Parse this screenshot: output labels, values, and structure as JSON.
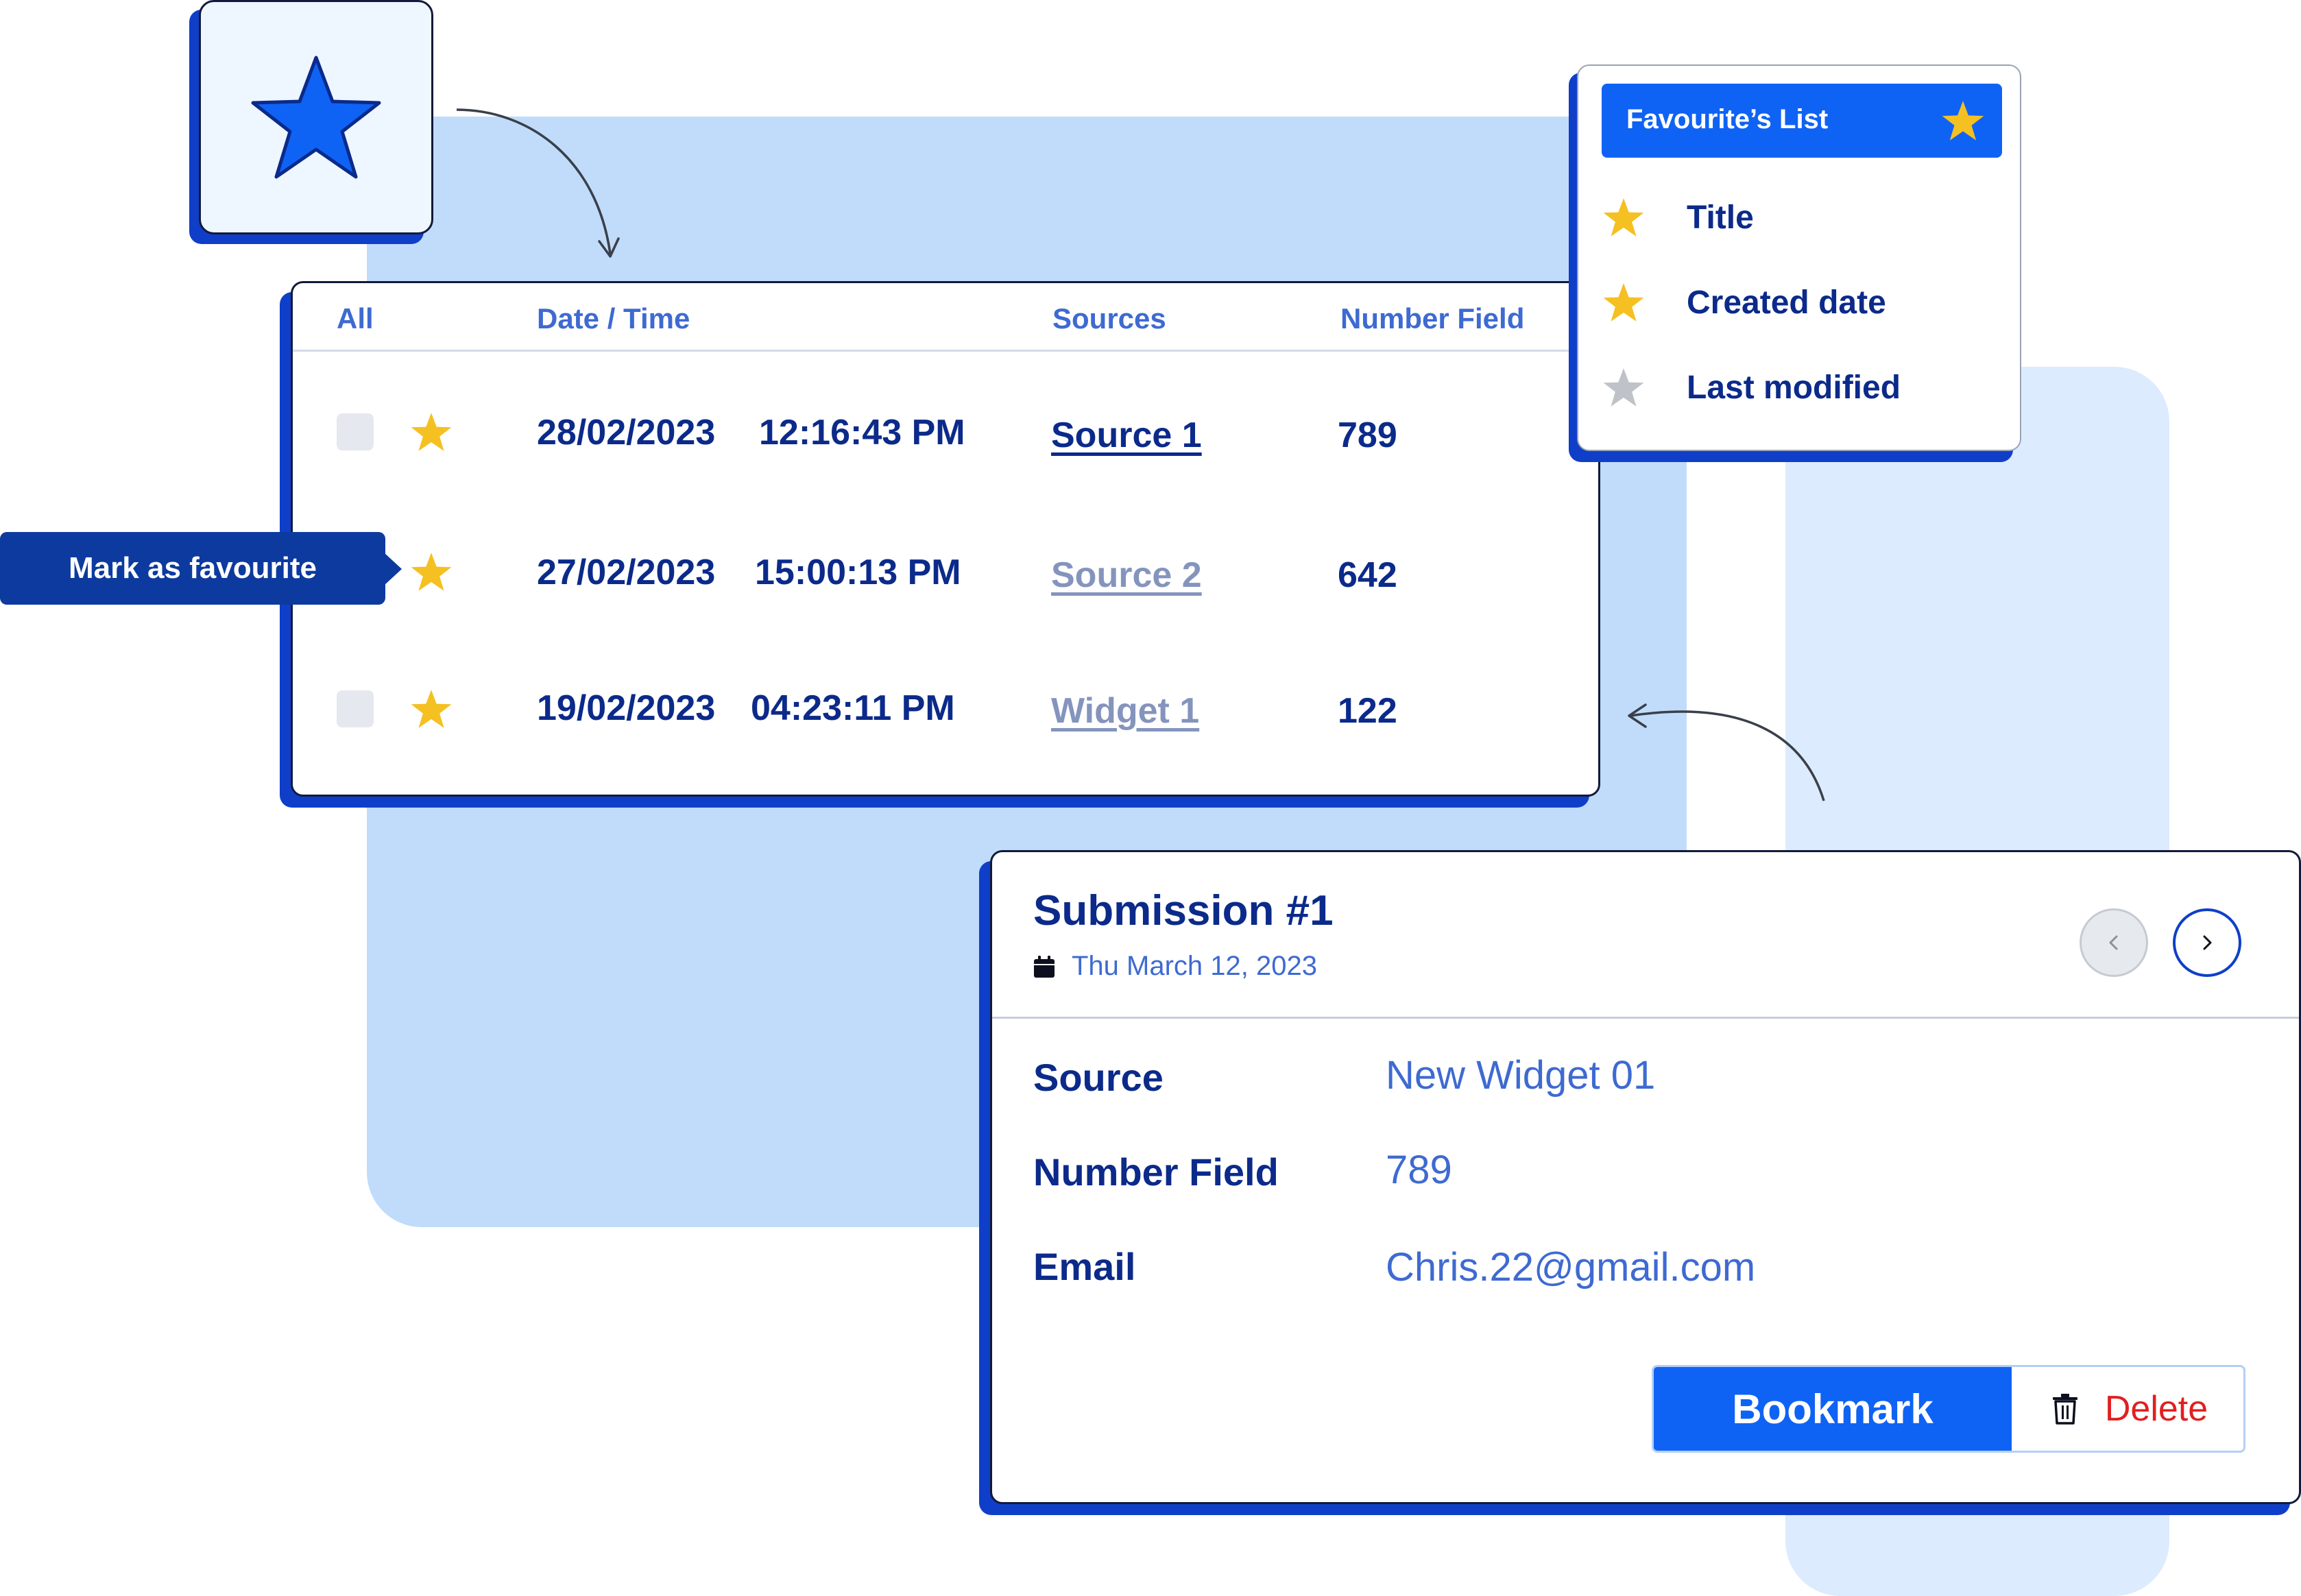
{
  "colors": {
    "brand_blue": "#0f63f4",
    "dark_blue": "#0b2a8a",
    "shadow_blue": "#0f3fc8",
    "star_yellow": "#f5c021",
    "star_gray": "#bfc3c9",
    "delete_red": "#e02020",
    "panel_light": "#c0dcfa"
  },
  "hero_icon": "star-icon",
  "table": {
    "headers": {
      "all": "All",
      "datetime": "Date / Time",
      "sources": "Sources",
      "number": "Number Field"
    },
    "rows": [
      {
        "date": "28/02/2023",
        "time": "12:16:43 PM",
        "source": "Source 1",
        "number": "789",
        "favourite": true
      },
      {
        "date": "27/02/2023",
        "time": "15:00:13 PM",
        "source": "Source 2",
        "number": "642",
        "favourite": true
      },
      {
        "date": "19/02/2023",
        "time": "04:23:11 PM",
        "source": "Widget 1",
        "number": "122",
        "favourite": true
      }
    ]
  },
  "tooltip": {
    "label": "Mark as favourite"
  },
  "favourites": {
    "title": "Favourite’s List",
    "items": [
      {
        "label": "Title",
        "starred": true
      },
      {
        "label": "Created date",
        "starred": true
      },
      {
        "label": "Last modified",
        "starred": false
      }
    ]
  },
  "submission": {
    "title": "Submission #1",
    "date": "Thu March 12, 2023",
    "fields": [
      {
        "label": "Source",
        "value": "New Widget 01"
      },
      {
        "label": "Number Field",
        "value": "789"
      },
      {
        "label": "Email",
        "value": "Chris.22@gmail.com"
      }
    ],
    "bookmark_label": "Bookmark",
    "delete_label": "Delete"
  }
}
